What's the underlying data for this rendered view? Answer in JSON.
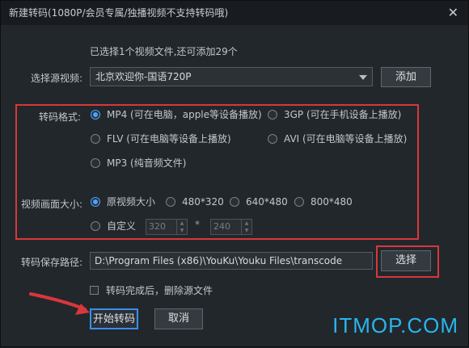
{
  "window": {
    "title": "新建转码(1080P/会员专属/独播视频不支持转码哦)"
  },
  "info_text": "已选择1个视频文件,还可添加29个",
  "source": {
    "label": "选择源视频:",
    "value": "北京欢迎你-国语720P",
    "add_button": "添加"
  },
  "format": {
    "label": "转码格式:",
    "options": [
      {
        "label": "MP4 (可在电脑，apple等设备播放)",
        "selected": true
      },
      {
        "label": "3GP (可在手机设备上播放)",
        "selected": false
      },
      {
        "label": "FLV (可在电脑等设备上播放)",
        "selected": false
      },
      {
        "label": "AVI (可在电脑等设备上播放)",
        "selected": false
      },
      {
        "label": "MP3 (纯音频文件)",
        "selected": false
      }
    ]
  },
  "size": {
    "label": "视频画面大小:",
    "options": [
      {
        "label": "原视频大小",
        "selected": true
      },
      {
        "label": "480*320",
        "selected": false
      },
      {
        "label": "640*480",
        "selected": false
      },
      {
        "label": "800*480",
        "selected": false
      }
    ],
    "custom": {
      "label": "自定义",
      "width": "320",
      "separator": "*",
      "height": "240"
    }
  },
  "save": {
    "label": "转码保存路径:",
    "path": "D:\\Program Files (x86)\\YouKu\\Youku Files\\transcode",
    "browse_button": "选择"
  },
  "delete_source": {
    "label": "转码完成后，删除源文件",
    "checked": false
  },
  "actions": {
    "start": "开始转码",
    "cancel": "取消"
  },
  "watermark": "ITMOP.COM",
  "colors": {
    "accent": "#4aa3ff",
    "highlight": "#d9373b",
    "watermark": "#2ab5ec"
  }
}
